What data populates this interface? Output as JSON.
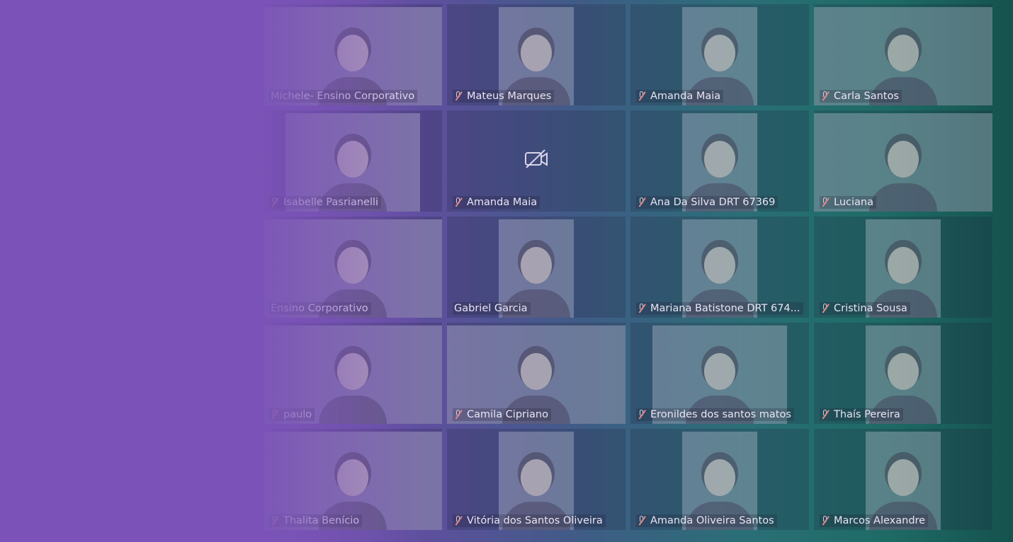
{
  "meeting": {
    "participants": [
      {
        "name": "Michele- Ensino Corporativo",
        "muted": false,
        "video": true
      },
      {
        "name": "Mateus Marques",
        "muted": true,
        "video": true
      },
      {
        "name": "Amanda Maia",
        "muted": true,
        "video": true
      },
      {
        "name": "Carla Santos",
        "muted": true,
        "video": true
      },
      {
        "name": "Isabelle Pasrianelli",
        "muted": true,
        "video": true
      },
      {
        "name": "Amanda Maia",
        "muted": true,
        "video": false
      },
      {
        "name": "Ana Da Silva DRT 67369",
        "muted": true,
        "video": true
      },
      {
        "name": "Luciana",
        "muted": true,
        "video": true
      },
      {
        "name": "Ensino Corporativo",
        "muted": false,
        "video": true
      },
      {
        "name": "Gabriel Garcia",
        "muted": false,
        "video": true
      },
      {
        "name": "Mariana Batistone DRT 674...",
        "muted": true,
        "video": true
      },
      {
        "name": "Cristina Sousa",
        "muted": true,
        "video": true
      },
      {
        "name": "paulo",
        "muted": true,
        "video": true
      },
      {
        "name": "Camila Cipriano",
        "muted": true,
        "video": true
      },
      {
        "name": "Eronildes dos santos matos",
        "muted": true,
        "video": true
      },
      {
        "name": "Thaís Pereira",
        "muted": true,
        "video": true
      },
      {
        "name": "Thalita Benício",
        "muted": true,
        "video": true
      },
      {
        "name": "Vitória dos Santos Oliveira",
        "muted": true,
        "video": true
      },
      {
        "name": "Amanda Oliveira Santos",
        "muted": true,
        "video": true
      },
      {
        "name": "Marcos Alexandre",
        "muted": true,
        "video": true
      }
    ],
    "camera_off_icon": "camera-off-icon",
    "mic_icon": "mic-muted-icon"
  },
  "colors": {
    "background_left": "#7b53b8",
    "background_right": "#15524e"
  }
}
